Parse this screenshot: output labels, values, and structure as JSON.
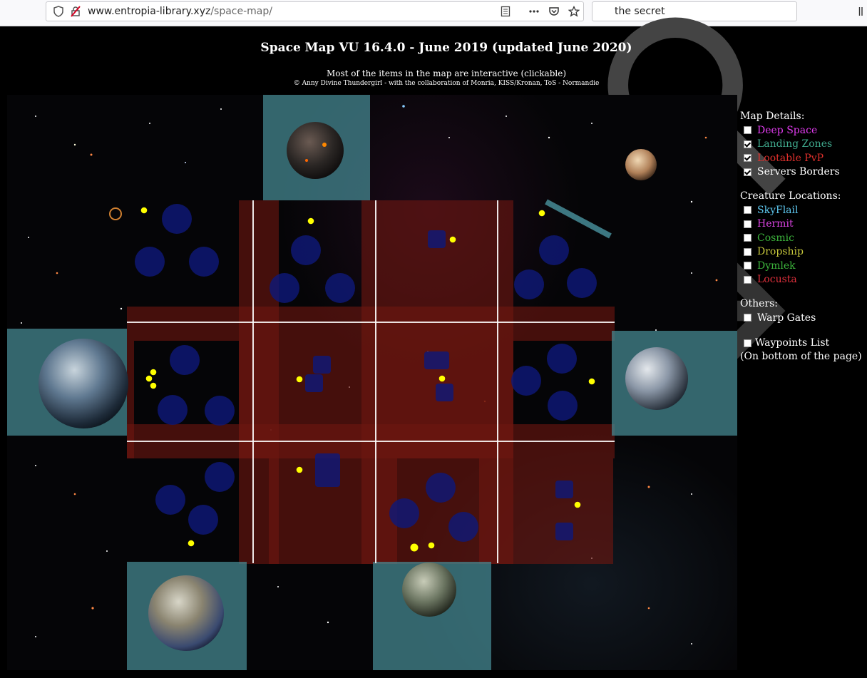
{
  "browser": {
    "url_host": "www.entropia-library.xyz",
    "url_path": "/space-map/",
    "search_text": "the secret"
  },
  "page": {
    "title": "Space Map VU 16.4.0 - June 2019 (updated June 2020)",
    "subtitle": "Most of the items in the map are interactive (clickable)",
    "credits": "© Anny Divine Thundergirl - with the collaboration of Monria, KISS/Kronan, ToS - Normandie"
  },
  "panel": {
    "map_details_heading": "Map Details:",
    "map_details": [
      {
        "label": "Deep Space",
        "checked": false,
        "color": "#e23cf0"
      },
      {
        "label": "Landing Zones",
        "checked": true,
        "color": "#3fa88c"
      },
      {
        "label": "Lootable PvP",
        "checked": true,
        "color": "#e0302c"
      },
      {
        "label": "Servers Borders",
        "checked": true,
        "color": "#ffffff"
      }
    ],
    "creature_heading": "Creature Locations:",
    "creatures": [
      {
        "label": "SkyFlail",
        "checked": false,
        "color": "#5ec8f0"
      },
      {
        "label": "Hermit",
        "checked": false,
        "color": "#d843e0"
      },
      {
        "label": "Cosmic",
        "checked": false,
        "color": "#3cb43c"
      },
      {
        "label": "Dropship",
        "checked": false,
        "color": "#c8c83c"
      },
      {
        "label": "Dymlek",
        "checked": false,
        "color": "#3cb43c"
      },
      {
        "label": "Locusta",
        "checked": false,
        "color": "#e0303c"
      }
    ],
    "others_heading": "Others:",
    "warp_gates": {
      "label": "Warp Gates",
      "checked": false
    },
    "waypoints": {
      "label": "Waypoints List",
      "checked": false,
      "note": "(On bottom of the page)"
    }
  },
  "map_colors": {
    "pvp": "rgba(110,22,16,0.62)",
    "landing_zone": "rgba(70,140,150,0.72)",
    "asteroid_zone": "rgba(15,25,120,0.82)",
    "marker": "#ffff00",
    "border": "#ffffff"
  }
}
